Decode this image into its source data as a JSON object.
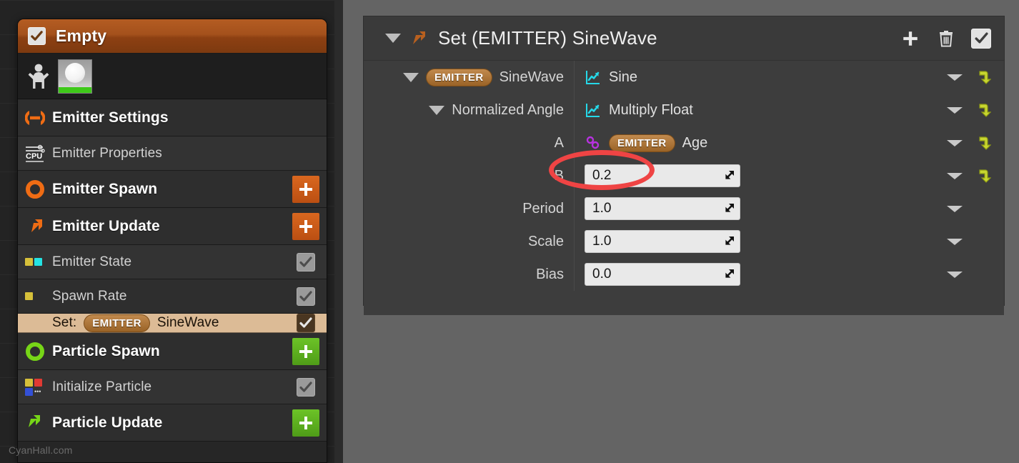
{
  "emitter_panel": {
    "title": "Empty",
    "header_checked": true,
    "thumbnail_icon": "character-icon",
    "rows": [
      {
        "label": "Emitter Settings",
        "kind": "group",
        "icon": "emitter-settings-icon",
        "action": "none"
      },
      {
        "label": "Emitter Properties",
        "kind": "module",
        "icon": "cpu-icon",
        "action": "none"
      },
      {
        "label": "Emitter Spawn",
        "kind": "group",
        "icon": "ring-orange-icon",
        "action": "plus-orange"
      },
      {
        "label": "Emitter Update",
        "kind": "group",
        "icon": "arrow-orange-icon",
        "action": "plus-orange"
      },
      {
        "label": "Emitter State",
        "kind": "module",
        "icon": "swatch-yellow-cyan-icon",
        "action": "check"
      },
      {
        "label": "Spawn Rate",
        "kind": "module",
        "icon": "swatch-yellow-icon",
        "action": "check"
      },
      {
        "label": "Set:",
        "kind": "selected",
        "pill": "EMITTER",
        "suffix": "SineWave",
        "icon": "none",
        "action": "check-dark"
      },
      {
        "label": "Particle Spawn",
        "kind": "group",
        "icon": "ring-green-icon",
        "action": "plus-green"
      },
      {
        "label": "Initialize Particle",
        "kind": "module",
        "icon": "swatch-multi-icon",
        "action": "check"
      },
      {
        "label": "Particle Update",
        "kind": "group",
        "icon": "arrow-green-icon",
        "action": "plus-green"
      }
    ]
  },
  "detail_panel": {
    "title": "Set (EMITTER) SineWave",
    "title_icon": "set-node-icon",
    "tools": [
      {
        "name": "add-button",
        "icon": "plus-icon"
      },
      {
        "name": "delete-button",
        "icon": "trash-icon"
      },
      {
        "name": "enabled-checkbox",
        "icon": "check-icon"
      }
    ],
    "rows": [
      {
        "indent": 0,
        "expander": "open",
        "pill": "EMITTER",
        "name": "SineWave",
        "value_type": "node",
        "value_icon": "graph-icon",
        "value": "Sine",
        "has_caret": true,
        "has_reset": true
      },
      {
        "indent": 1,
        "expander": "open",
        "name": "Normalized Angle",
        "value_type": "node",
        "value_icon": "graph-icon",
        "value": "Multiply Float",
        "has_caret": true,
        "has_reset": true
      },
      {
        "indent": 2,
        "name": "A",
        "value_type": "link",
        "value_icon": "link-icon",
        "pill": "EMITTER",
        "value": "Age",
        "has_caret": true,
        "has_reset": true
      },
      {
        "indent": 2,
        "name": "B",
        "value_type": "number",
        "value": "0.2",
        "has_caret": true,
        "has_reset": true,
        "highlighted": true
      },
      {
        "indent": 1,
        "name": "Period",
        "value_type": "number",
        "value": "1.0",
        "has_caret": true,
        "has_reset": false
      },
      {
        "indent": 1,
        "name": "Scale",
        "value_type": "number",
        "value": "1.0",
        "has_caret": true,
        "has_reset": false
      },
      {
        "indent": 1,
        "name": "Bias",
        "value_type": "number",
        "value": "0.0",
        "has_caret": true,
        "has_reset": false
      }
    ]
  },
  "annotation": {
    "shape": "ellipse",
    "color": "#ef4444",
    "targets": "0.2"
  },
  "watermark": "CyanHall.com",
  "colors": {
    "accent_orange": "#f2701a",
    "header_orange": "#a4511c",
    "selected_tan": "#dcbb96",
    "green": "#5fb522",
    "graph_cyan": "#25d8e8",
    "link_purple": "#b832e0",
    "reset_yellow": "#c8d630"
  }
}
